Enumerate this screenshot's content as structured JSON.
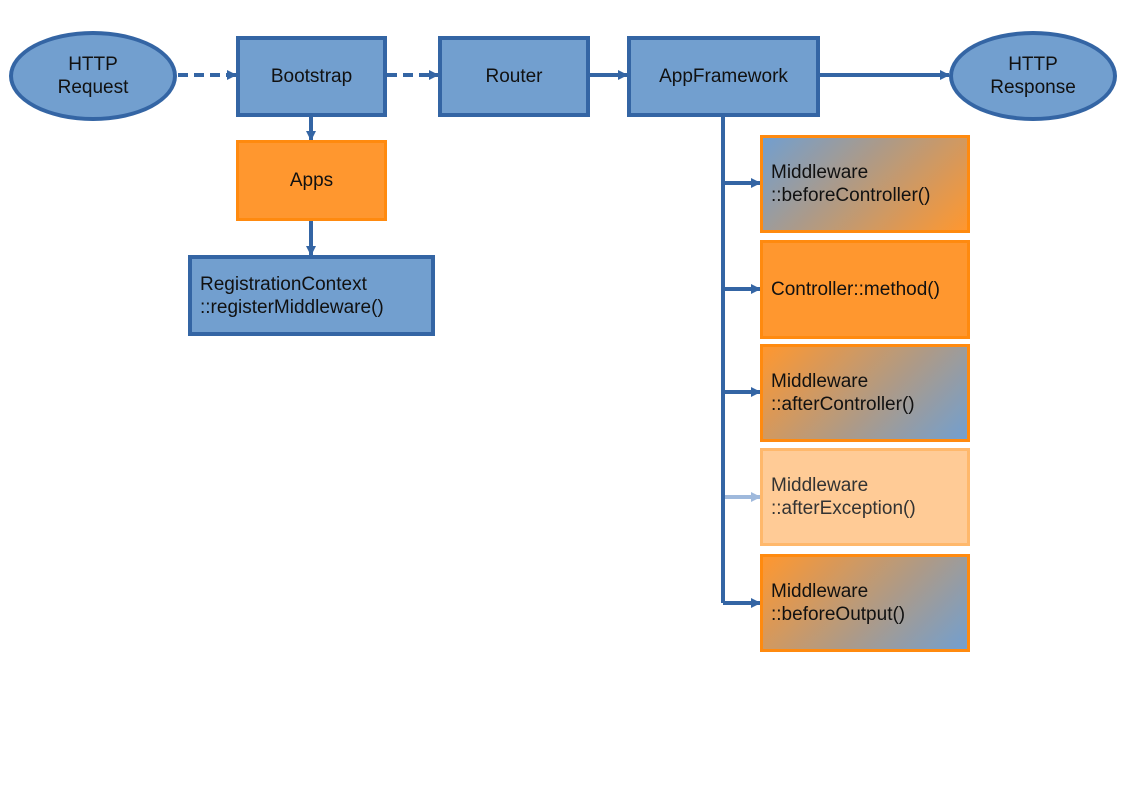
{
  "diagram": {
    "colors": {
      "blue_fill": "#729fcf",
      "blue_stroke": "#3465a4",
      "orange_fill": "#ff972f",
      "orange_stroke": "#ff8a0f",
      "faded_fill": "#ffcb96",
      "faded_arrow": "#9fb9dc"
    },
    "nodes": {
      "http_request": {
        "line1": "HTTP",
        "line2": "Request"
      },
      "bootstrap": {
        "label": "Bootstrap"
      },
      "router": {
        "label": "Router"
      },
      "appframework": {
        "label": "AppFramework"
      },
      "http_response": {
        "line1": "HTTP",
        "line2": "Response"
      },
      "apps": {
        "label": "Apps"
      },
      "registration": {
        "line1": "RegistrationContext",
        "line2": "::registerMiddleware()"
      },
      "before_controller": {
        "line1": "Middleware",
        "line2": "::beforeController()"
      },
      "controller_method": {
        "label": "Controller::method()"
      },
      "after_controller": {
        "line1": "Middleware",
        "line2": "::afterController()"
      },
      "after_exception": {
        "line1": "Middleware",
        "line2": "::afterException()"
      },
      "before_output": {
        "line1": "Middleware",
        "line2": "::beforeOutput()"
      }
    },
    "edges": [
      {
        "from": "http_request",
        "to": "bootstrap",
        "style": "dashed"
      },
      {
        "from": "bootstrap",
        "to": "router",
        "style": "dashed"
      },
      {
        "from": "router",
        "to": "appframework",
        "style": "solid"
      },
      {
        "from": "appframework",
        "to": "http_response",
        "style": "solid"
      },
      {
        "from": "bootstrap",
        "to": "apps",
        "style": "solid"
      },
      {
        "from": "apps",
        "to": "registration",
        "style": "solid"
      },
      {
        "from": "appframework",
        "to": "before_controller",
        "style": "solid"
      },
      {
        "from": "appframework",
        "to": "controller_method",
        "style": "solid"
      },
      {
        "from": "appframework",
        "to": "after_controller",
        "style": "solid"
      },
      {
        "from": "appframework",
        "to": "after_exception",
        "style": "faded"
      },
      {
        "from": "appframework",
        "to": "before_output",
        "style": "solid"
      }
    ]
  }
}
